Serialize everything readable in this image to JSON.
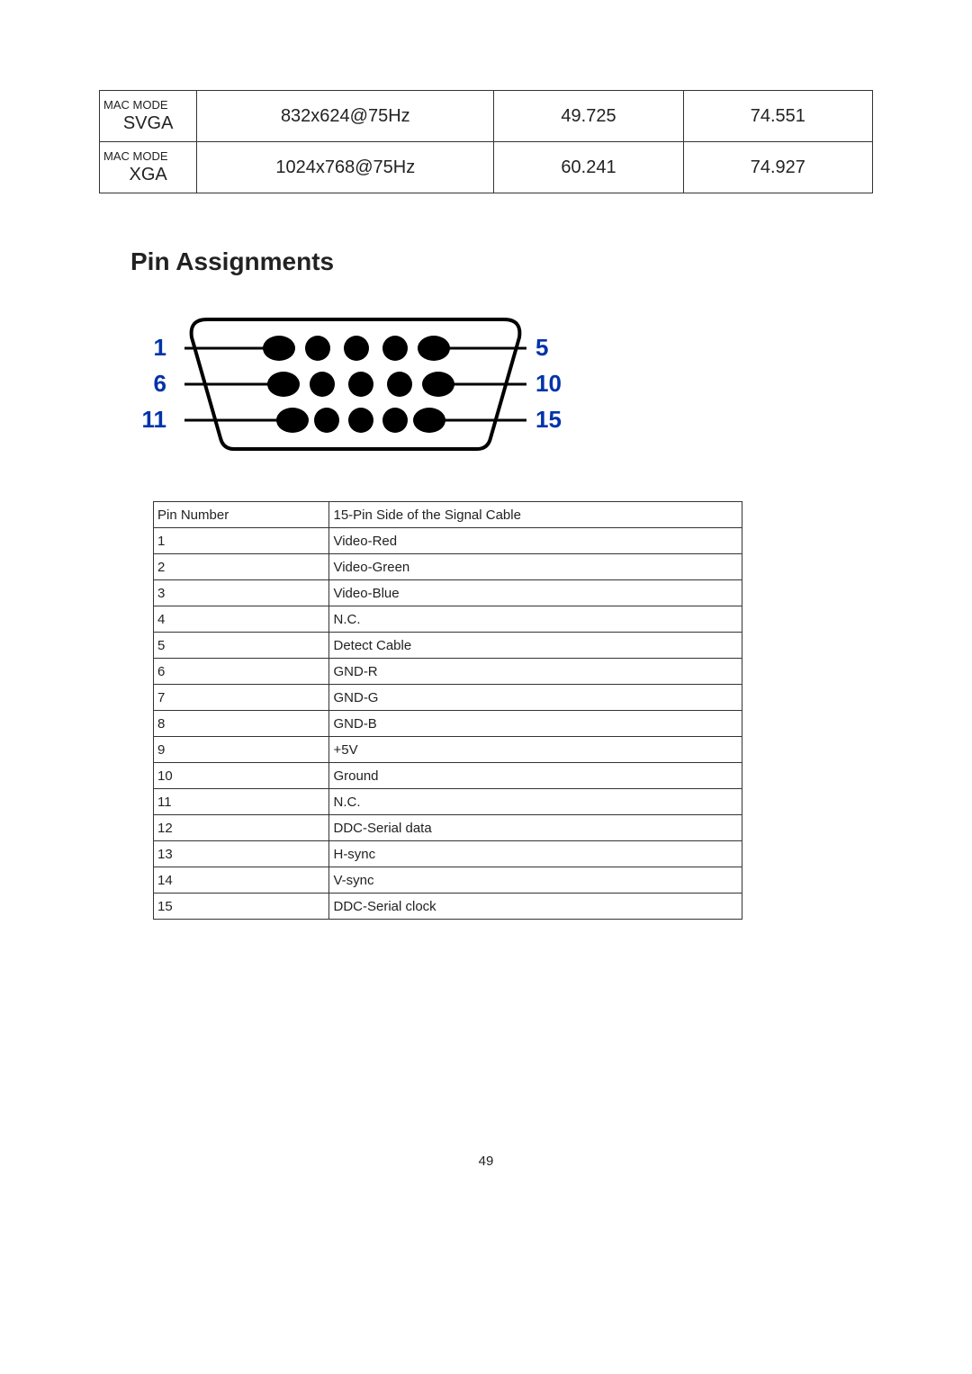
{
  "mode_table": {
    "rows": [
      {
        "mac": "MAC MODE",
        "name": "SVGA",
        "resolution": "832x624@75Hz",
        "v1": "49.725",
        "v2": "74.551"
      },
      {
        "mac": "MAC MODE",
        "name": "XGA",
        "resolution": "1024x768@75Hz",
        "v1": "60.241",
        "v2": "74.927"
      }
    ]
  },
  "heading": "Pin Assignments",
  "diagram_labels": {
    "left": [
      "1",
      "6",
      "11"
    ],
    "right": [
      "5",
      "10",
      "15"
    ]
  },
  "pin_table": {
    "headers": {
      "num": "Pin Number",
      "desc": "15-Pin Side of the Signal Cable"
    },
    "rows": [
      {
        "num": "1",
        "desc": "Video-Red"
      },
      {
        "num": "2",
        "desc": "Video-Green"
      },
      {
        "num": "3",
        "desc": "Video-Blue"
      },
      {
        "num": "4",
        "desc": "N.C."
      },
      {
        "num": "5",
        "desc": "Detect Cable"
      },
      {
        "num": "6",
        "desc": "GND-R"
      },
      {
        "num": "7",
        "desc": "GND-G"
      },
      {
        "num": "8",
        "desc": "GND-B"
      },
      {
        "num": "9",
        "desc": "+5V"
      },
      {
        "num": "10",
        "desc": "Ground"
      },
      {
        "num": "11",
        "desc": "N.C."
      },
      {
        "num": "12",
        "desc": "DDC-Serial data"
      },
      {
        "num": "13",
        "desc": "H-sync"
      },
      {
        "num": "14",
        "desc": "V-sync"
      },
      {
        "num": "15",
        "desc": "DDC-Serial clock"
      }
    ]
  },
  "page_number": "49"
}
